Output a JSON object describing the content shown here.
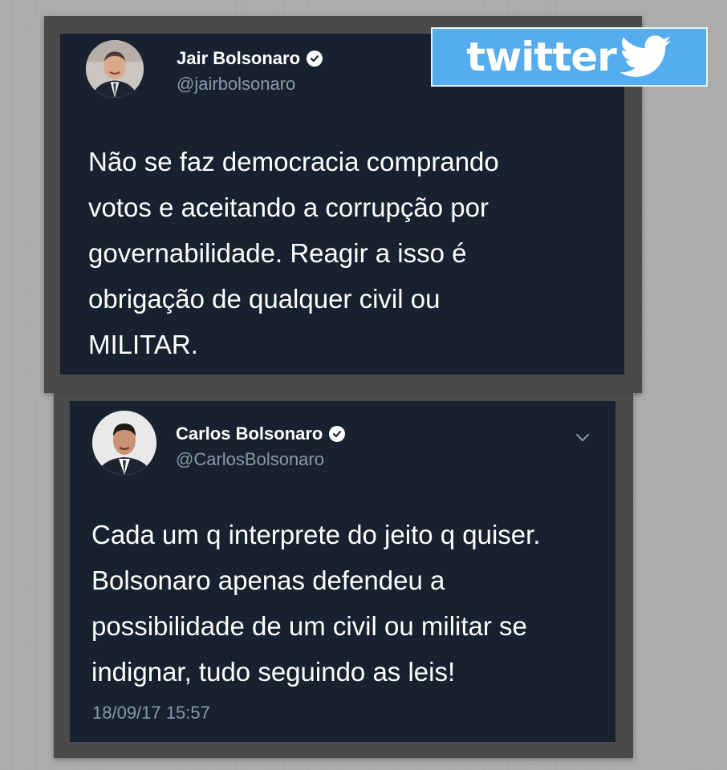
{
  "brand": {
    "logo_text": "twitter",
    "colors": {
      "badge": "#55acee",
      "card_background": "#182130",
      "handle": "#8899a6"
    }
  },
  "tweets": [
    {
      "name": "Jair Bolsonaro",
      "handle": "@jairbolsonaro",
      "verified": true,
      "text": "Não se faz democracia comprando\nvotos e aceitando a corrupção por\ngovernabilidade. Reagir a isso é\nobrigação de qualquer civil ou\nMILITAR."
    },
    {
      "name": "Carlos Bolsonaro",
      "handle": "@CarlosBolsonaro",
      "verified": true,
      "text": "Cada um q interprete do jeito q quiser.\nBolsonaro apenas defendeu a\npossibilidade de um civil ou militar se\nindignar, tudo seguindo as leis!",
      "timestamp": "18/09/17 15:57",
      "menu_icon": "chevron-down-icon"
    }
  ]
}
